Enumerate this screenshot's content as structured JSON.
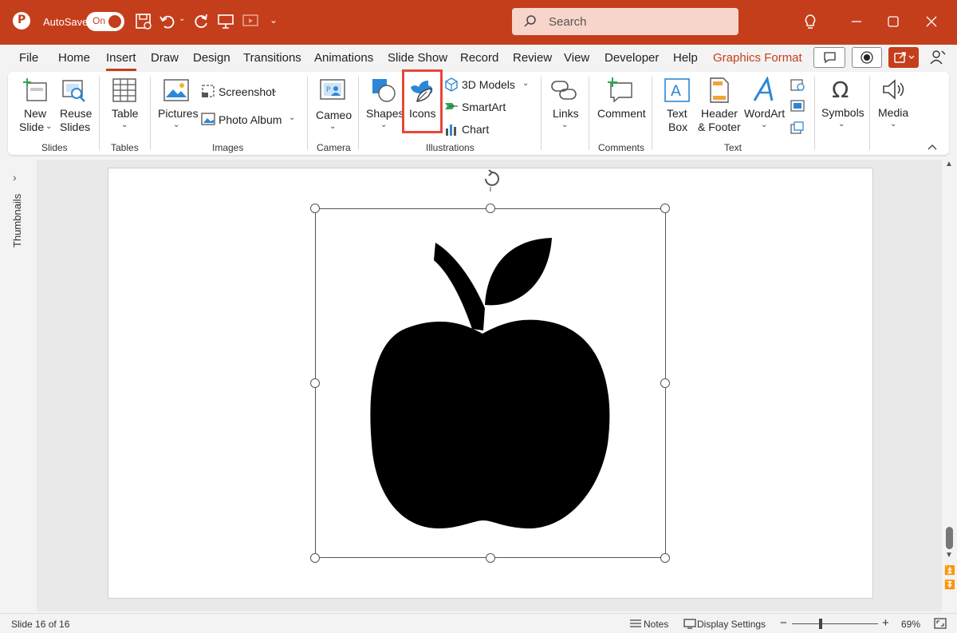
{
  "titlebar": {
    "autosave_label": "AutoSave",
    "toggle_state": "On",
    "search_placeholder": "Search"
  },
  "tabs": [
    {
      "label": "File"
    },
    {
      "label": "Home"
    },
    {
      "label": "Insert",
      "active": true
    },
    {
      "label": "Draw"
    },
    {
      "label": "Design"
    },
    {
      "label": "Transitions"
    },
    {
      "label": "Animations"
    },
    {
      "label": "Slide Show"
    },
    {
      "label": "Record"
    },
    {
      "label": "Review"
    },
    {
      "label": "View"
    },
    {
      "label": "Developer"
    },
    {
      "label": "Help"
    },
    {
      "label": "Graphics Format",
      "contextual": true
    }
  ],
  "ribbon": {
    "slides": {
      "group": "Slides",
      "new_slide_1": "New",
      "new_slide_2": "Slide",
      "reuse_1": "Reuse",
      "reuse_2": "Slides"
    },
    "tables": {
      "group": "Tables",
      "table": "Table"
    },
    "images": {
      "group": "Images",
      "pictures": "Pictures",
      "screenshot": "Screenshot",
      "photo_album": "Photo Album"
    },
    "camera": {
      "group": "Camera",
      "cameo": "Cameo"
    },
    "illustrations": {
      "group": "Illustrations",
      "shapes": "Shapes",
      "icons": "Icons",
      "models_3d": "3D Models",
      "smartart": "SmartArt",
      "chart": "Chart"
    },
    "links": {
      "links": "Links"
    },
    "comments": {
      "group": "Comments",
      "comment": "Comment"
    },
    "text": {
      "group": "Text",
      "textbox_1": "Text",
      "textbox_2": "Box",
      "header_1": "Header",
      "header_2": "& Footer",
      "wordart": "WordArt"
    },
    "symbols": {
      "symbols": "Symbols"
    },
    "media": {
      "media": "Media"
    }
  },
  "left_pane": {
    "thumbnails_label": "Thumbnails"
  },
  "slide": {
    "icon_name": "apple-icon"
  },
  "status": {
    "slide_counter": "Slide 16 of 16",
    "notes": "Notes",
    "display_settings": "Display Settings",
    "zoom_minus": "−",
    "zoom_plus": "+",
    "zoom_level": "69%"
  },
  "colors": {
    "accent": "#c43e1c",
    "highlight": "#e8473a",
    "icon_blue": "#2b88d8"
  }
}
